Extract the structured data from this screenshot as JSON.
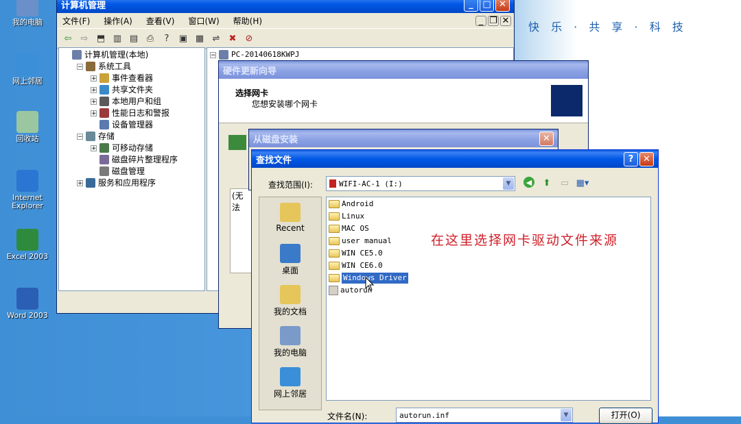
{
  "desktop": {
    "brand_slogan": "快 乐 · 共 享 · 科 技",
    "icons": [
      {
        "label": "我的电脑",
        "icon": "my-computer-icon",
        "color": "#6b8fc8"
      },
      {
        "label": "网上邻居",
        "icon": "network-icon",
        "color": "#3a8fd8"
      },
      {
        "label": "回收站",
        "icon": "recycle-bin-icon",
        "color": "#9bc7a0"
      },
      {
        "label": "Internet Explorer",
        "icon": "internet-explorer-icon",
        "color": "#2b76d2"
      },
      {
        "label": "Excel 2003",
        "icon": "excel-icon",
        "color": "#2e8b3e"
      },
      {
        "label": "Word 2003",
        "icon": "word-icon",
        "color": "#2a5fb5"
      }
    ]
  },
  "computer_mgmt": {
    "title": "计算机管理",
    "menu": [
      "文件(F)",
      "操作(A)",
      "查看(V)",
      "窗口(W)",
      "帮助(H)"
    ],
    "tree": [
      {
        "label": "计算机管理(本地)",
        "level": 0,
        "exp": ""
      },
      {
        "label": "系统工具",
        "level": 1,
        "exp": "−"
      },
      {
        "label": "事件查看器",
        "level": 2,
        "exp": "+"
      },
      {
        "label": "共享文件夹",
        "level": 2,
        "exp": "+"
      },
      {
        "label": "本地用户和组",
        "level": 2,
        "exp": "+"
      },
      {
        "label": "性能日志和警报",
        "level": 2,
        "exp": "+"
      },
      {
        "label": "设备管理器",
        "level": 2,
        "exp": ""
      },
      {
        "label": "存储",
        "level": 1,
        "exp": "−"
      },
      {
        "label": "可移动存储",
        "level": 2,
        "exp": "+"
      },
      {
        "label": "磁盘碎片整理程序",
        "level": 2,
        "exp": ""
      },
      {
        "label": "磁盘管理",
        "level": 2,
        "exp": ""
      },
      {
        "label": "服务和应用程序",
        "level": 1,
        "exp": "+"
      }
    ],
    "right_tree_root": "PC-20140618KWPJ"
  },
  "hw_wizard": {
    "title": "硬件更新向导",
    "heading": "选择网卡",
    "subheading": "您想安装哪个网卡",
    "partial_text": "(无法"
  },
  "install_from_disk": {
    "title": "从磁盘安装"
  },
  "find_file": {
    "title": "查找文件",
    "look_in_label": "查找范围(I):",
    "look_in_value": "WIFI-AC-1 (I:)",
    "places": [
      "Recent",
      "桌面",
      "我的文档",
      "我的电脑",
      "网上邻居"
    ],
    "files": [
      {
        "name": "Android",
        "type": "folder"
      },
      {
        "name": "Linux",
        "type": "folder"
      },
      {
        "name": "MAC OS",
        "type": "folder"
      },
      {
        "name": "user manual",
        "type": "folder"
      },
      {
        "name": "WIN CE5.0",
        "type": "folder"
      },
      {
        "name": "WIN CE6.0",
        "type": "folder"
      },
      {
        "name": "Windows Driver",
        "type": "folder",
        "selected": true
      },
      {
        "name": "autorun",
        "type": "file"
      }
    ],
    "filename_label": "文件名(N):",
    "filename_value": "autorun.inf",
    "open_button": "打开(O)",
    "annotation": "在这里选择网卡驱动文件来源"
  }
}
